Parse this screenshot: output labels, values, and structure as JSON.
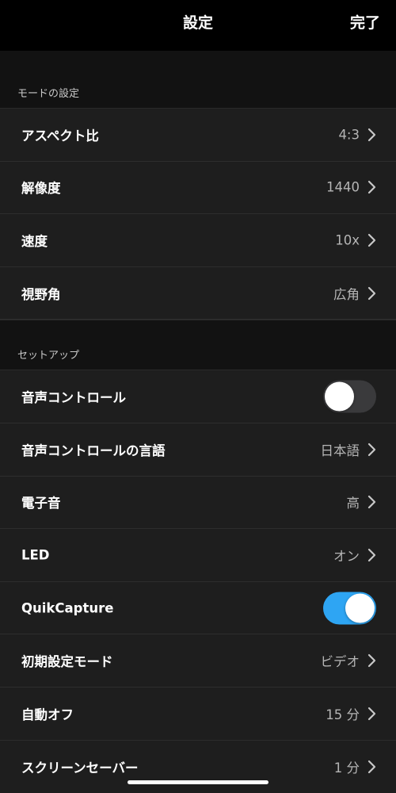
{
  "header": {
    "title": "設定",
    "done_label": "完了"
  },
  "sections": [
    {
      "title": "モードの設定",
      "rows": [
        {
          "label": "アスペクト比",
          "value": "4:3"
        },
        {
          "label": "解像度",
          "value": "1440"
        },
        {
          "label": "速度",
          "value": "10x"
        },
        {
          "label": "視野角",
          "value": "広角"
        }
      ]
    },
    {
      "title": "セットアップ",
      "rows": [
        {
          "label": "音声コントロール",
          "toggle": false
        },
        {
          "label": "音声コントロールの言語",
          "value": "日本語"
        },
        {
          "label": "電子音",
          "value": "高"
        },
        {
          "label": "LED",
          "value": "オン"
        },
        {
          "label": "QuikCapture",
          "toggle": true
        },
        {
          "label": "初期設定モード",
          "value": "ビデオ"
        },
        {
          "label": "自動オフ",
          "value": "15 分"
        },
        {
          "label": "スクリーンセーバー",
          "value": "1 分"
        }
      ]
    }
  ],
  "colors": {
    "background": "#121212",
    "row_background": "#1e1e1e",
    "navbar": "#000000",
    "toggle_on": "#2ea5f3",
    "toggle_off": "#3a3a3c"
  },
  "icons": {
    "chevron": "chevron-right-icon"
  }
}
